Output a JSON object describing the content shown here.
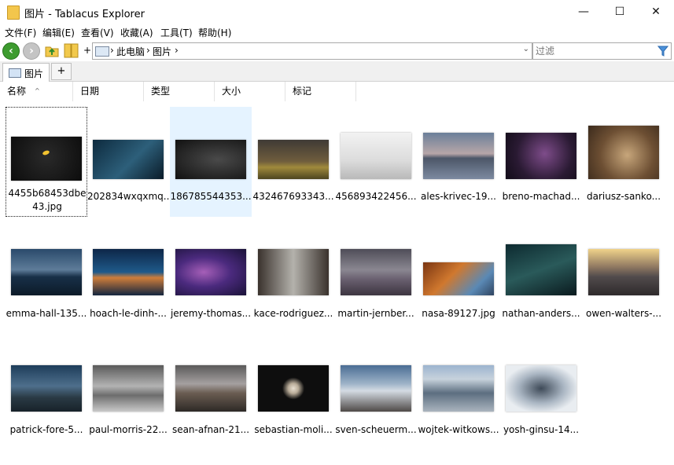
{
  "window": {
    "title": "图片 - Tablacus Explorer",
    "minimize": "—",
    "maximize": "☐",
    "close": "✕"
  },
  "menu": [
    "文件(F)",
    "编辑(E)",
    "查看(V)",
    "收藏(A)",
    "工具(T)",
    "帮助(H)"
  ],
  "toolbar": {
    "back_icon": "back-arrow-icon",
    "forward_icon": "forward-arrow-icon",
    "up_icon": "up-folder-icon",
    "folders_icon": "folders-icon",
    "add_label": "+",
    "address": {
      "crumbs": [
        "›",
        "此电脑",
        "›",
        "图片",
        "›"
      ]
    },
    "filter_placeholder": "过滤"
  },
  "tabs": [
    {
      "label": "图片"
    }
  ],
  "tab_add": "+",
  "columns": [
    "名称",
    "日期",
    "类型",
    "大小",
    "标记"
  ],
  "files": [
    {
      "name": "4455b68453dbe43.jpg",
      "selected": false,
      "focused": true
    },
    {
      "name": "202834wxqxmq...",
      "selected": false
    },
    {
      "name": "186785544353...",
      "selected": true
    },
    {
      "name": "432467693343...",
      "selected": false
    },
    {
      "name": "456893422456...",
      "selected": false
    },
    {
      "name": "ales-krivec-19...",
      "selected": false
    },
    {
      "name": "breno-machad...",
      "selected": false
    },
    {
      "name": "dariusz-sanko...",
      "selected": false
    },
    {
      "name": "emma-hall-135...",
      "selected": false
    },
    {
      "name": "hoach-le-dinh-...",
      "selected": false
    },
    {
      "name": "jeremy-thomas...",
      "selected": false
    },
    {
      "name": "kace-rodriguez...",
      "selected": false
    },
    {
      "name": "martin-jernber...",
      "selected": false
    },
    {
      "name": "nasa-89127.jpg",
      "selected": false
    },
    {
      "name": "nathan-anders...",
      "selected": false
    },
    {
      "name": "owen-walters-...",
      "selected": false
    },
    {
      "name": "patrick-fore-5...",
      "selected": false
    },
    {
      "name": "paul-morris-22...",
      "selected": false
    },
    {
      "name": "sean-afnan-21...",
      "selected": false
    },
    {
      "name": "sebastian-moli...",
      "selected": false
    },
    {
      "name": "sven-scheuerm...",
      "selected": false
    },
    {
      "name": "wojtek-witkows...",
      "selected": false
    },
    {
      "name": "yosh-ginsu-14...",
      "selected": false
    }
  ]
}
